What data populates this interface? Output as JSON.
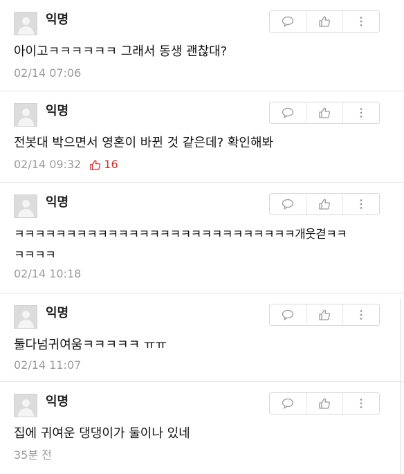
{
  "comments": [
    {
      "nick": "익명",
      "text": "아이고ㅋㅋㅋㅋㅋㅋ 그래서 동생 괜찮대?",
      "time": "02/14 07:06",
      "likes": ""
    },
    {
      "nick": "익명",
      "text": "전봇대 박으면서 영혼이 바뀐 것 같은데? 확인해봐",
      "time": "02/14 09:32",
      "likes": "16"
    },
    {
      "nick": "익명",
      "text": "ㅋㅋㅋㅋㅋㅋㅋㅋㅋㅋㅋㅋㅋㅋㅋㅋㅋㅋㅋㅋㅋㅋㅋㅋㅋㅋㅋ개웃겯ㅋㅋ\nㅋㅋㅋㅋ",
      "time": "02/14 10:18",
      "likes": ""
    },
    {
      "nick": "익명",
      "text": "둘다넘귀여움ㅋㅋㅋㅋㅋ ㅠㅠ",
      "time": "02/14 11:07",
      "likes": ""
    },
    {
      "nick": "익명",
      "text": "집에 귀여운 댕댕이가 둘이나 있네",
      "time": "35분 전",
      "likes": ""
    }
  ],
  "icons": {
    "reply": "speech-bubble-icon",
    "like": "thumbs-up-icon",
    "more": "more-vertical-icon"
  },
  "colors": {
    "like_count": "#c4332e",
    "meta_text": "#9a9a9a"
  }
}
